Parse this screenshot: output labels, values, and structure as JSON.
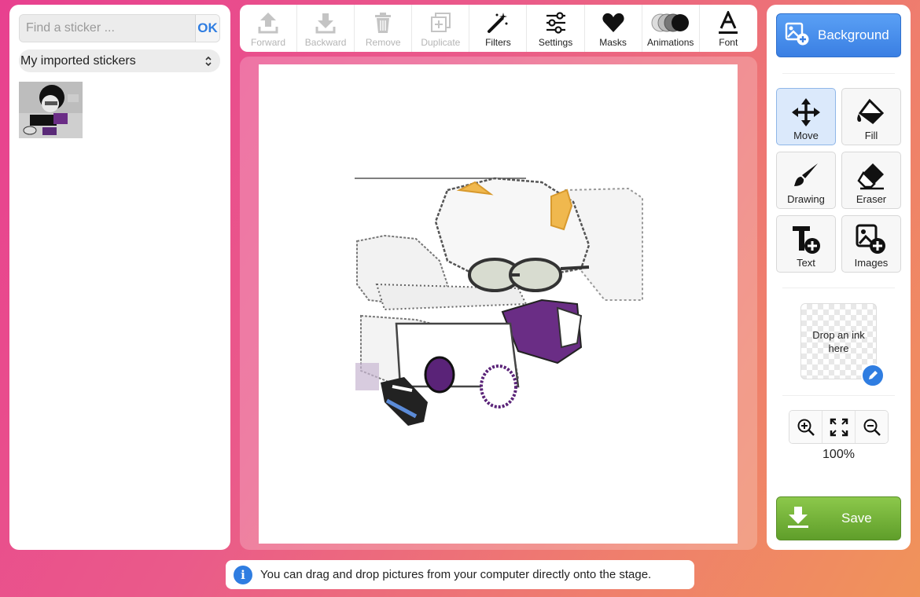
{
  "search": {
    "placeholder": "Find a sticker ...",
    "ok_label": "OK"
  },
  "sticker_category": {
    "selected": "My imported stickers"
  },
  "toolbar": [
    {
      "label": "Forward",
      "icon": "forward-icon",
      "disabled": true
    },
    {
      "label": "Backward",
      "icon": "backward-icon",
      "disabled": true
    },
    {
      "label": "Remove",
      "icon": "trash-icon",
      "disabled": true
    },
    {
      "label": "Duplicate",
      "icon": "duplicate-icon",
      "disabled": true
    },
    {
      "label": "Filters",
      "icon": "magic-wand-icon",
      "disabled": false
    },
    {
      "label": "Settings",
      "icon": "sliders-icon",
      "disabled": false
    },
    {
      "label": "Masks",
      "icon": "heart-icon",
      "disabled": false
    },
    {
      "label": "Animations",
      "icon": "animation-circles-icon",
      "disabled": false
    },
    {
      "label": "Font",
      "icon": "font-icon",
      "disabled": false
    }
  ],
  "right_panel": {
    "background_label": "Background",
    "tools": [
      {
        "label": "Move",
        "icon": "move-icon",
        "active": true
      },
      {
        "label": "Fill",
        "icon": "paint-bucket-icon",
        "active": false
      },
      {
        "label": "Drawing",
        "icon": "brush-icon",
        "active": false
      },
      {
        "label": "Eraser",
        "icon": "eraser-icon",
        "active": false
      },
      {
        "label": "Text",
        "icon": "add-text-icon",
        "active": false
      },
      {
        "label": "Images",
        "icon": "add-image-icon",
        "active": false
      }
    ],
    "ink_drop_label": "Drop an ink here",
    "zoom_level": "100%",
    "save_label": "Save"
  },
  "tip": {
    "text": "You can drag and drop pictures from your computer directly onto the stage."
  },
  "colors": {
    "accent_blue": "#2f7de1",
    "save_green": "#6aaa32",
    "background_pink": "#e8408f",
    "background_orange": "#f0935a"
  }
}
